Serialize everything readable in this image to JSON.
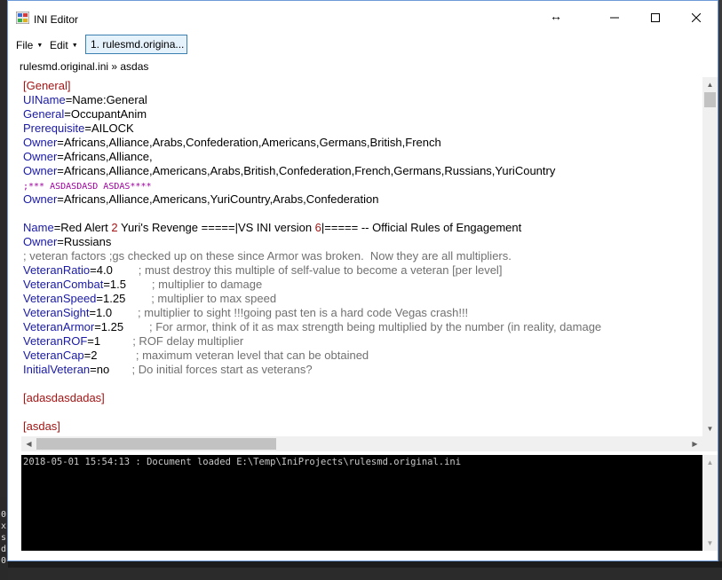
{
  "window": {
    "title": "INI Editor",
    "minimize_glyph": "─",
    "maximize_glyph": "☐",
    "close_glyph": "✕",
    "resize_glyph": "↔"
  },
  "menu": {
    "file_label": "File",
    "edit_label": "Edit",
    "caret": "▼",
    "document_tab_label": "1. rulesmd.origina..."
  },
  "breadcrumb": "rulesmd.original.ini » asdas",
  "scroll": {
    "up": "▲",
    "down": "▼",
    "left": "◀",
    "right": "▶"
  },
  "editor": {
    "lines": [
      [
        {
          "t": "[General]",
          "c": "sec"
        }
      ],
      [
        {
          "t": "UIName",
          "c": "key"
        },
        {
          "t": "=Name:General",
          "c": "val"
        }
      ],
      [
        {
          "t": "General",
          "c": "key"
        },
        {
          "t": "=OccupantAnim",
          "c": "val"
        }
      ],
      [
        {
          "t": "Prerequisite",
          "c": "key"
        },
        {
          "t": "=AILOCK",
          "c": "val"
        }
      ],
      [
        {
          "t": "Owner",
          "c": "key"
        },
        {
          "t": "=Africans,Alliance,Arabs,Confederation,Americans,Germans,British,French",
          "c": "val"
        }
      ],
      [
        {
          "t": "Owner",
          "c": "key"
        },
        {
          "t": "=Africans,Alliance,",
          "c": "val"
        }
      ],
      [
        {
          "t": "Owner",
          "c": "key"
        },
        {
          "t": "=Africans,Alliance,Americans,Arabs,British,Confederation,French,Germans,Russians,YuriCountry",
          "c": "val"
        }
      ],
      [
        {
          "t": ";*** ASDASDASD ASDAS****",
          "c": "cmt-bold"
        }
      ],
      [
        {
          "t": "Owner",
          "c": "key"
        },
        {
          "t": "=Africans,Alliance,Americans,YuriCountry,Arabs,Confederation",
          "c": "val"
        }
      ],
      [],
      [
        {
          "t": "Name",
          "c": "key"
        },
        {
          "t": "=Red Alert ",
          "c": "val"
        },
        {
          "t": "2",
          "c": "num"
        },
        {
          "t": " Yuri's Revenge =====|VS INI version ",
          "c": "val"
        },
        {
          "t": "6",
          "c": "num"
        },
        {
          "t": "|===== -- Official Rules of Engagement",
          "c": "val"
        }
      ],
      [
        {
          "t": "Owner",
          "c": "key"
        },
        {
          "t": "=Russians",
          "c": "val"
        }
      ],
      [
        {
          "t": "; veteran factors ;gs checked up on these since Armor was broken.  Now they are all multipliers.",
          "c": "cmt"
        }
      ],
      [
        {
          "t": "VeteranRatio",
          "c": "key"
        },
        {
          "t": "=4.0",
          "c": "val"
        },
        {
          "t": "        ; must destroy this multiple of self-value to become a veteran [per level]",
          "c": "cmt"
        }
      ],
      [
        {
          "t": "VeteranCombat",
          "c": "key"
        },
        {
          "t": "=1.5",
          "c": "val"
        },
        {
          "t": "        ; multiplier to damage",
          "c": "cmt"
        }
      ],
      [
        {
          "t": "VeteranSpeed",
          "c": "key"
        },
        {
          "t": "=1.25",
          "c": "val"
        },
        {
          "t": "        ; multiplier to max speed",
          "c": "cmt"
        }
      ],
      [
        {
          "t": "VeteranSight",
          "c": "key"
        },
        {
          "t": "=1.0",
          "c": "val"
        },
        {
          "t": "        ; multiplier to sight !!!going past ten is a hard code Vegas crash!!!",
          "c": "cmt"
        }
      ],
      [
        {
          "t": "VeteranArmor",
          "c": "key"
        },
        {
          "t": "=1.25",
          "c": "val"
        },
        {
          "t": "        ; For armor, think of it as max strength being multiplied by the number (in reality, damage",
          "c": "cmt"
        }
      ],
      [
        {
          "t": "VeteranROF",
          "c": "key"
        },
        {
          "t": "=1",
          "c": "val"
        },
        {
          "t": "          ; ROF delay multiplier",
          "c": "cmt"
        }
      ],
      [
        {
          "t": "VeteranCap",
          "c": "key"
        },
        {
          "t": "=2",
          "c": "val"
        },
        {
          "t": "            ; maximum veteran level that can be obtained",
          "c": "cmt"
        }
      ],
      [
        {
          "t": "InitialVeteran",
          "c": "key"
        },
        {
          "t": "=no",
          "c": "val"
        },
        {
          "t": "       ; Do initial forces start as veterans?",
          "c": "cmt"
        }
      ],
      [],
      [
        {
          "t": "[adasdasdadas]",
          "c": "sec"
        }
      ],
      [],
      [
        {
          "t": "[asdas]",
          "c": "sec"
        }
      ]
    ]
  },
  "console": {
    "text": "2018-05-01 15:54:13 : Document loaded E:\\Temp\\IniProjects\\rulesmd.original.ini"
  },
  "background": {
    "left_chars": "0\nx\ns\nd\n0"
  },
  "colors": {
    "section": "#a31515",
    "key": "#1a1aa6",
    "comment": "#707070",
    "accent": "#3c7fb1"
  }
}
